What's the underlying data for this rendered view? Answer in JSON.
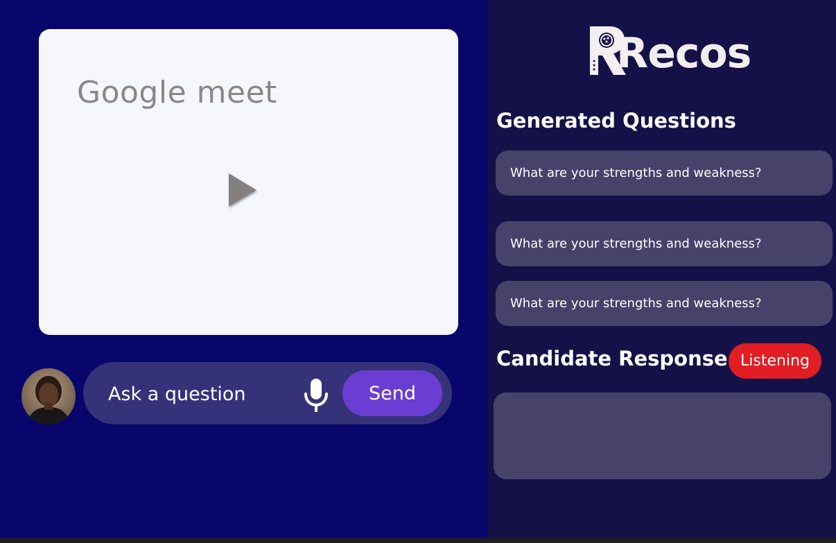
{
  "video": {
    "title": "Google meet",
    "play_icon": "play-icon"
  },
  "ask": {
    "placeholder": "Ask a question",
    "mic_icon": "microphone-icon",
    "send_label": "Send"
  },
  "brand": {
    "name": "Recos"
  },
  "questions": {
    "title": "Generated Questions",
    "items": [
      {
        "text": "What are your strengths and weakness?"
      },
      {
        "text": "What are your strengths and weakness?"
      },
      {
        "text": "What are your strengths and weakness?"
      }
    ]
  },
  "response": {
    "title": "Candidate Response",
    "status": "Listening",
    "text": ""
  },
  "colors": {
    "left_background": "#08066a",
    "right_background": "#141148",
    "card": "#47426a",
    "send_button": "#6a3ed2",
    "listening_badge": "#e21d24"
  }
}
